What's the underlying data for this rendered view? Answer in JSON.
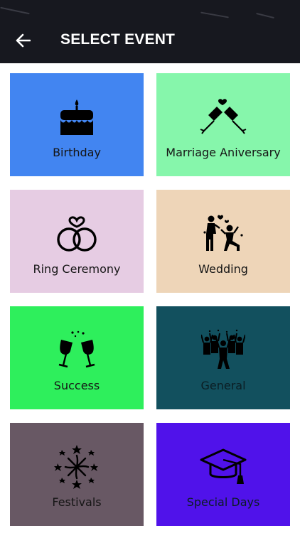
{
  "header": {
    "title": "SELECT EVENT",
    "back_icon": "arrow-left-icon",
    "background": "#17181f"
  },
  "events": [
    {
      "label": "Birthday",
      "icon": "birthday-cake-icon",
      "color": "#4285f1"
    },
    {
      "label": "Marriage Aniversary",
      "icon": "champagne-toast-icon",
      "color": "#86f6ab"
    },
    {
      "label": "Ring Ceremony",
      "icon": "rings-icon",
      "color": "#e6cce3"
    },
    {
      "label": "Wedding",
      "icon": "dancing-couple-icon",
      "color": "#eed5b8"
    },
    {
      "label": "Success",
      "icon": "wine-cheers-icon",
      "color": "#2eef5c"
    },
    {
      "label": "General",
      "icon": "party-crowd-icon",
      "color": "#12505e"
    },
    {
      "label": "Festivals",
      "icon": "fireworks-icon",
      "color": "#685864"
    },
    {
      "label": "Special Days",
      "icon": "graduation-cap-icon",
      "color": "#5012ea"
    }
  ]
}
